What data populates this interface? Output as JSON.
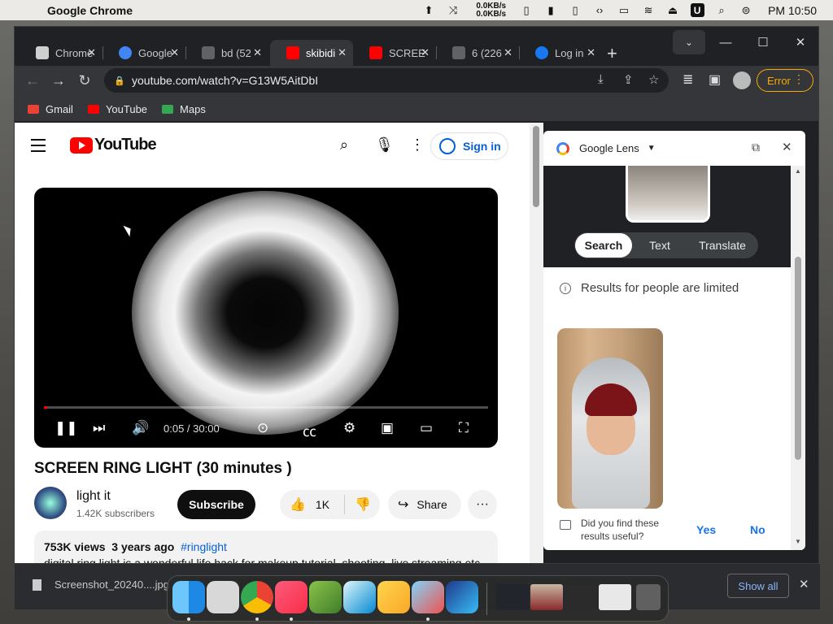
{
  "menubar": {
    "apple_glyph": "",
    "app_name": "Google Chrome",
    "net_up": "0.0KB/s",
    "net_down": "0.0KB/s",
    "badge": "U",
    "clock": "PM 10:50"
  },
  "tabs": [
    {
      "label": "Chrome",
      "favicon_color": "#e8eaed",
      "active": false
    },
    {
      "label": "Google",
      "favicon_color": "#4285f4",
      "active": false
    },
    {
      "label": "bd (52",
      "favicon_color": "#5f6368",
      "active": false
    },
    {
      "label": "skibidi",
      "favicon_color": "#ff0000",
      "active": true
    },
    {
      "label": "SCREE",
      "favicon_color": "#ff0000",
      "active": false
    },
    {
      "label": "6 (226",
      "favicon_color": "#5f6368",
      "active": false
    },
    {
      "label": "Log in",
      "favicon_color": "#1877f2",
      "active": false
    }
  ],
  "toolbar": {
    "url": "youtube.com/watch?v=G13W5AitDbI",
    "error_label": "Error"
  },
  "bookmarks": [
    {
      "label": "Gmail",
      "color": "#ea4335"
    },
    {
      "label": "YouTube",
      "color": "#ff0000"
    },
    {
      "label": "Maps",
      "color": "#34a853"
    }
  ],
  "youtube": {
    "logo_text": "YouTube",
    "sign_in": "Sign in",
    "player": {
      "time": "0:05 / 30:00",
      "progress_fraction": 0.003
    },
    "video_title": "SCREEN RING LIGHT (30 minutes )",
    "channel": {
      "name": "light it",
      "subscribers": "1.42K subscribers"
    },
    "subscribe_label": "Subscribe",
    "likes": "1K",
    "share_label": "Share",
    "description": {
      "views": "753K views",
      "age": "3 years ago",
      "tag": "#ringlight",
      "text": "digital ring light is a wonderful life hack for makeup tutorial, shooting, live streaming etc"
    }
  },
  "lens": {
    "title": "Google Lens",
    "tabs": [
      "Search",
      "Text",
      "Translate"
    ],
    "active_tab": "Search",
    "limited_notice": "Results for people are limited",
    "feedback_question": "Did you find these results useful?",
    "yes": "Yes",
    "no": "No"
  },
  "downloads": {
    "file": "Screenshot_20240....jpg",
    "show_all": "Show all"
  },
  "dock": {
    "apps": [
      "finder",
      "launchpad",
      "chrome",
      "music",
      "preview",
      "migration",
      "artifact",
      "paint",
      "star-app"
    ],
    "accent_colors": {
      "chrome": "#4285f4",
      "music": "#fa2d48",
      "finder": "#1e88e5"
    }
  }
}
